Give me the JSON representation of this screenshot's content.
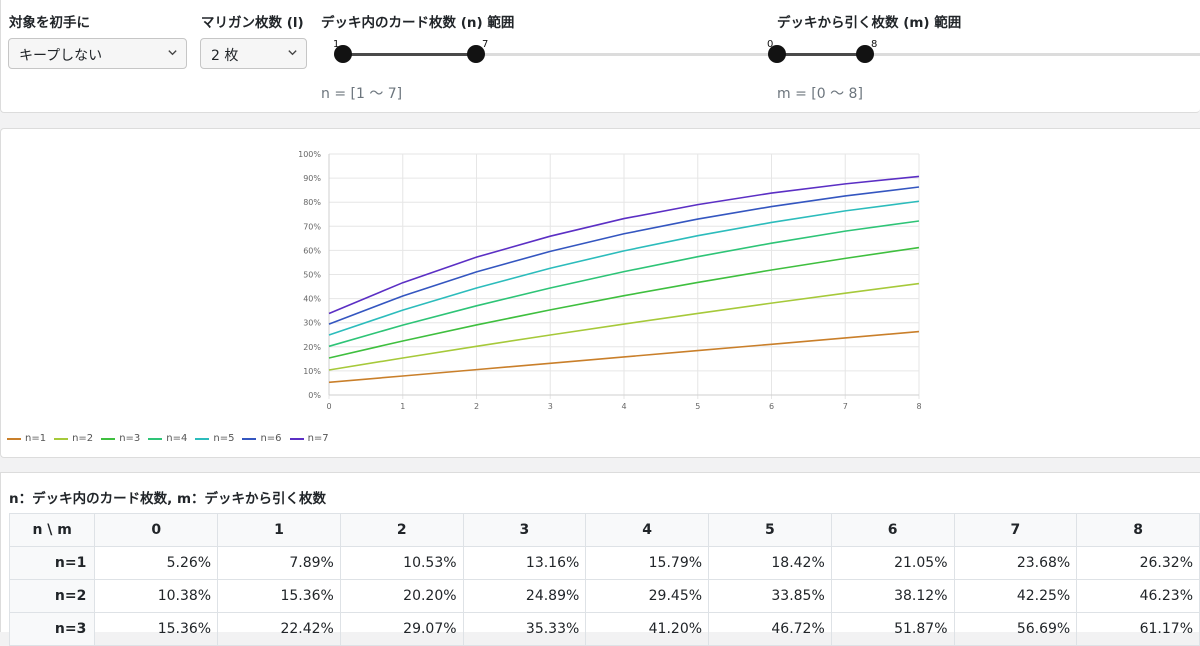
{
  "controls": {
    "target_label": "対象を初手に",
    "target_value": "キープしない",
    "mulligan_label": "マリガン枚数 (l)",
    "mulligan_value": "2 枚",
    "n_label": "デッキ内のカード枚数 (n) 範囲",
    "n_min": "1",
    "n_max": "7",
    "n_range_text": "n = [1 〜 7]",
    "m_label": "デッキから引く枚数 (m) 範囲",
    "m_min": "0",
    "m_max": "8",
    "m_range_text": "m = [0 〜 8]"
  },
  "chart_data": {
    "type": "line",
    "x": [
      0,
      1,
      2,
      3,
      4,
      5,
      6,
      7,
      8
    ],
    "ylim": [
      0,
      100
    ],
    "y_ticks": [
      "0%",
      "10%",
      "20%",
      "30%",
      "40%",
      "50%",
      "60%",
      "70%",
      "80%",
      "90%",
      "100%"
    ],
    "x_ticks": [
      "0",
      "1",
      "2",
      "3",
      "4",
      "5",
      "6",
      "7",
      "8"
    ],
    "grid": true,
    "legend_position": "bottom-left",
    "series": [
      {
        "name": "n=1",
        "color": "#c97f2a",
        "values": [
          5.26,
          7.89,
          10.53,
          13.16,
          15.79,
          18.42,
          21.05,
          23.68,
          26.32
        ]
      },
      {
        "name": "n=2",
        "color": "#a6c93a",
        "values": [
          10.38,
          15.36,
          20.2,
          24.89,
          29.45,
          33.85,
          38.12,
          42.25,
          46.23
        ]
      },
      {
        "name": "n=3",
        "color": "#3fbf3f",
        "values": [
          15.36,
          22.42,
          29.07,
          35.33,
          41.2,
          46.72,
          51.87,
          56.69,
          61.17
        ]
      },
      {
        "name": "n=4",
        "color": "#2ec477",
        "values": [
          20.2,
          29.0,
          37.0,
          44.4,
          51.2,
          57.4,
          63.0,
          68.0,
          72.2
        ]
      },
      {
        "name": "n=5",
        "color": "#2cbcbc",
        "values": [
          24.9,
          35.2,
          44.4,
          52.6,
          59.8,
          66.1,
          71.6,
          76.4,
          80.4
        ]
      },
      {
        "name": "n=6",
        "color": "#3456c0",
        "values": [
          29.4,
          41.1,
          51.1,
          59.6,
          66.9,
          73.0,
          78.2,
          82.6,
          86.3
        ]
      },
      {
        "name": "n=7",
        "color": "#5b2fc4",
        "values": [
          33.8,
          46.6,
          57.2,
          65.9,
          73.2,
          79.0,
          83.8,
          87.6,
          90.7
        ]
      }
    ]
  },
  "table": {
    "title": "n：デッキ内のカード枚数, m：デッキから引く枚数",
    "corner": "n \\ m",
    "columns": [
      "0",
      "1",
      "2",
      "3",
      "4",
      "5",
      "6",
      "7",
      "8"
    ],
    "rows": [
      {
        "label": "n=1",
        "cells": [
          "5.26%",
          "7.89%",
          "10.53%",
          "13.16%",
          "15.79%",
          "18.42%",
          "21.05%",
          "23.68%",
          "26.32%"
        ]
      },
      {
        "label": "n=2",
        "cells": [
          "10.38%",
          "15.36%",
          "20.20%",
          "24.89%",
          "29.45%",
          "33.85%",
          "38.12%",
          "42.25%",
          "46.23%"
        ]
      },
      {
        "label": "n=3",
        "cells": [
          "15.36%",
          "22.42%",
          "29.07%",
          "35.33%",
          "41.20%",
          "46.72%",
          "51.87%",
          "56.69%",
          "61.17%"
        ]
      }
    ]
  }
}
